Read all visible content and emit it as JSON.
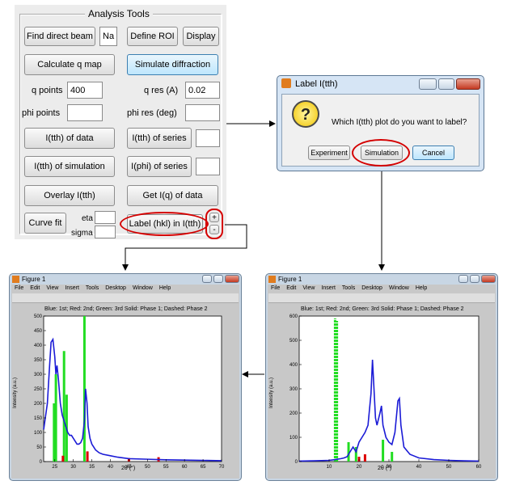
{
  "panel": {
    "title": "Analysis Tools",
    "find_beam": "Find direct beam",
    "beam_value": "Na",
    "define_roi": "Define ROI",
    "display": "Display",
    "calc_qmap": "Calculate q map",
    "simulate": "Simulate diffraction",
    "q_points_label": "q points",
    "q_points_value": "400",
    "q_res_label": "q res (A)",
    "q_res_value": "0.02",
    "phi_points_label": "phi points",
    "phi_points_value": "",
    "phi_res_label": "phi res (deg)",
    "phi_res_value": "",
    "ith_data": "I(tth) of data",
    "ith_series": "I(tth) of series",
    "ith_series_value": "",
    "ith_sim": "I(tth) of simulation",
    "iphi_series": "I(phi) of series",
    "iphi_series_value": "",
    "overlay": "Overlay I(tth)",
    "get_iq": "Get I(q) of data",
    "curve_fit": "Curve fit",
    "eta_label": "eta",
    "sigma_label": "sigma",
    "label_hkl": "Label (hkl) in I(tth)",
    "plus": "+",
    "minus": "-"
  },
  "dialog": {
    "title": "Label I(tth)",
    "question": "Which I(tth) plot do you want to label?",
    "experiment": "Experiment",
    "simulation": "Simulation",
    "cancel": "Cancel",
    "icon": "question-icon"
  },
  "menus": [
    "File",
    "Edit",
    "View",
    "Insert",
    "Tools",
    "Desktop",
    "Window",
    "Help"
  ],
  "figure_left": {
    "title": "Figure 1",
    "plot_title": "Blue: 1st; Red: 2nd; Green: 3rd     Solid: Phase 1; Dashed: Phase 2",
    "ylabel": "Intensity (a.u.)",
    "xlabel": "2θ (°)"
  },
  "figure_right": {
    "title": "Figure 1",
    "plot_title": "Blue: 1st; Red: 2nd; Green: 3rd     Solid: Phase 1; Dashed: Phase 2",
    "ylabel": "Intensity (a.u.)",
    "xlabel": "2θ (°)"
  },
  "chart_data": [
    {
      "type": "line",
      "xlim": [
        22,
        70
      ],
      "ylim": [
        0,
        500
      ],
      "xticks": [
        "25",
        "30",
        "35",
        "40",
        "45",
        "50",
        "55",
        "60",
        "65",
        "70"
      ],
      "yticks": [
        "0",
        "50",
        "100",
        "150",
        "200",
        "250",
        "300",
        "350",
        "400",
        "450",
        "500"
      ],
      "series": [
        {
          "color": "#1b1bd6",
          "x": [
            22,
            23,
            23.6,
            24,
            24.5,
            25,
            25.3,
            25.6,
            26,
            26.5,
            27,
            27.5,
            28,
            28.5,
            29,
            29.5,
            30,
            30.5,
            31,
            31.5,
            32,
            32.5,
            33,
            33.3,
            33.7,
            34,
            34.5,
            35,
            36,
            37,
            38,
            40,
            42,
            45,
            50,
            55,
            60,
            65,
            70
          ],
          "y": [
            110,
            200,
            330,
            410,
            420,
            360,
            300,
            330,
            280,
            200,
            160,
            140,
            120,
            100,
            90,
            90,
            80,
            70,
            60,
            60,
            65,
            80,
            140,
            250,
            200,
            120,
            80,
            60,
            40,
            30,
            25,
            20,
            15,
            10,
            8,
            6,
            5,
            4,
            3
          ]
        }
      ],
      "sticks": [
        {
          "color": "#22dd22",
          "x": 24.8,
          "y": 200
        },
        {
          "color": "#22dd22",
          "x": 25.3,
          "y": 300
        },
        {
          "color": "#22dd22",
          "x": 27.5,
          "y": 380
        },
        {
          "color": "#22dd22",
          "x": 28.2,
          "y": 230
        },
        {
          "color": "#22dd22",
          "x": 33.0,
          "y": 500
        },
        {
          "color": "#dd0000",
          "x": 27.2,
          "y": 20
        },
        {
          "color": "#dd0000",
          "x": 33.8,
          "y": 35
        },
        {
          "color": "#dd0000",
          "x": 45.0,
          "y": 12
        },
        {
          "color": "#dd0000",
          "x": 53.0,
          "y": 15
        }
      ]
    },
    {
      "type": "line",
      "xlim": [
        0,
        60
      ],
      "ylim": [
        0,
        600
      ],
      "xticks": [
        "10",
        "20",
        "30",
        "40",
        "50",
        "60"
      ],
      "yticks": [
        "0",
        "100",
        "200",
        "300",
        "400",
        "500",
        "600"
      ],
      "series": [
        {
          "color": "#1b1bd6",
          "x": [
            0,
            5,
            10,
            12,
            14,
            15,
            16,
            18,
            19,
            20,
            21,
            22,
            23,
            24,
            24.5,
            25,
            25.5,
            26,
            27,
            27.5,
            28,
            29,
            30,
            31,
            32,
            33,
            33.5,
            34,
            35,
            37,
            40,
            45,
            50,
            55,
            60
          ],
          "y": [
            2,
            3,
            5,
            8,
            12,
            15,
            20,
            60,
            40,
            80,
            100,
            120,
            150,
            280,
            420,
            300,
            180,
            150,
            200,
            230,
            150,
            100,
            80,
            70,
            120,
            250,
            260,
            150,
            60,
            30,
            15,
            8,
            5,
            3,
            2
          ]
        }
      ],
      "sticks": [
        {
          "color": "#22dd22",
          "x": 12.0,
          "y": 590
        },
        {
          "color": "#22dd22",
          "x": 12.6,
          "y": 580
        },
        {
          "color": "#22dd22",
          "x": 16.5,
          "y": 80
        },
        {
          "color": "#22dd22",
          "x": 19.0,
          "y": 60
        },
        {
          "color": "#22dd22",
          "x": 28.0,
          "y": 90
        },
        {
          "color": "#22dd22",
          "x": 31.0,
          "y": 40
        },
        {
          "color": "#dd0000",
          "x": 20.0,
          "y": 20
        },
        {
          "color": "#dd0000",
          "x": 22.0,
          "y": 30
        }
      ]
    }
  ]
}
